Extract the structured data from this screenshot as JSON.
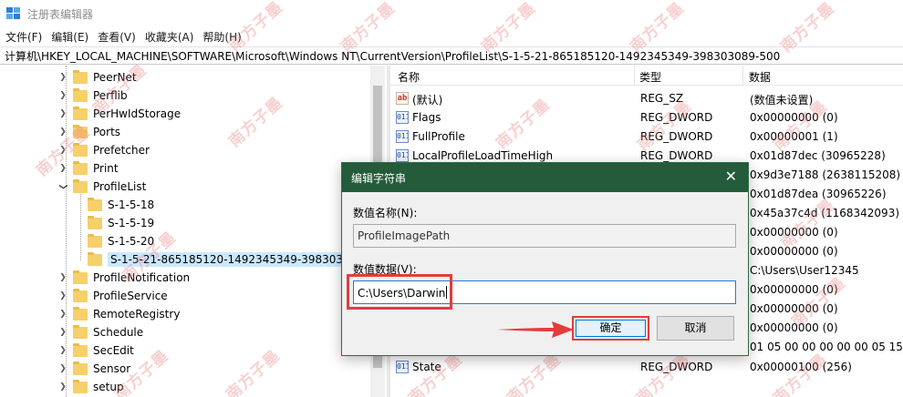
{
  "window": {
    "title": "注册表编辑器"
  },
  "menu": [
    "文件(F)",
    "编辑(E)",
    "查看(V)",
    "收藏夹(A)",
    "帮助(H)"
  ],
  "address": "计算机\\HKEY_LOCAL_MACHINE\\SOFTWARE\\Microsoft\\Windows NT\\CurrentVersion\\ProfileList\\S-1-5-21-865185120-1492345349-398303089-500",
  "tree": {
    "items": [
      {
        "label": "PeerNet",
        "expanded": false
      },
      {
        "label": "Perflib",
        "expanded": false
      },
      {
        "label": "PerHwIdStorage",
        "expanded": false
      },
      {
        "label": "Ports",
        "expanded": false
      },
      {
        "label": "Prefetcher",
        "expanded": false
      },
      {
        "label": "Print",
        "expanded": false
      },
      {
        "label": "ProfileList",
        "expanded": true
      },
      {
        "label": "S-1-5-18",
        "child": true
      },
      {
        "label": "S-1-5-19",
        "child": true
      },
      {
        "label": "S-1-5-20",
        "child": true
      },
      {
        "label": "S-1-5-21-865185120-1492345349-398303089",
        "child": true,
        "selected": true
      },
      {
        "label": "ProfileNotification",
        "expanded": false
      },
      {
        "label": "ProfileService",
        "expanded": false
      },
      {
        "label": "RemoteRegistry",
        "expanded": false
      },
      {
        "label": "Schedule",
        "expanded": false
      },
      {
        "label": "SecEdit",
        "expanded": false
      },
      {
        "label": "Sensor",
        "expanded": false
      },
      {
        "label": "setup",
        "expanded": false
      }
    ]
  },
  "values": {
    "headers": {
      "name": "名称",
      "type": "类型",
      "data": "数据"
    },
    "rows": [
      {
        "icon": "string-value-icon",
        "name": "(默认)",
        "type": "REG_SZ",
        "data": "(数值未设置)"
      },
      {
        "icon": "binary-value-icon",
        "name": "Flags",
        "type": "REG_DWORD",
        "data": "0x00000000 (0)"
      },
      {
        "icon": "binary-value-icon",
        "name": "FullProfile",
        "type": "REG_DWORD",
        "data": "0x00000001 (1)"
      },
      {
        "icon": "binary-value-icon",
        "name": "LocalProfileLoadTimeHigh",
        "type": "REG_DWORD",
        "data": "0x01d87dec (30965228)"
      },
      {
        "icon": "",
        "name": "",
        "type": "",
        "data": "0x9d3e7188 (2638115208)"
      },
      {
        "icon": "",
        "name": "",
        "type": "",
        "data": "0x01d87dea (30965226)"
      },
      {
        "icon": "",
        "name": "",
        "type": "",
        "data": "0x45a37c4d (1168342093)"
      },
      {
        "icon": "",
        "name": "",
        "type": "",
        "data": "0x00000000 (0)"
      },
      {
        "icon": "",
        "name": "",
        "type": "",
        "data": "0x00000000 (0)"
      },
      {
        "icon": "",
        "name": "",
        "type": "",
        "data": "C:\\Users\\User12345"
      },
      {
        "icon": "",
        "name": "",
        "type": "",
        "data": "0x00000000 (0)"
      },
      {
        "icon": "",
        "name": "",
        "type": "",
        "data": "0x00000000 (0)"
      },
      {
        "icon": "",
        "name": "",
        "type": "",
        "data": "0x00000000 (0)"
      },
      {
        "icon": "",
        "name": "",
        "type": "",
        "data": "01 05 00 00 00 00 00 05 15 0"
      },
      {
        "icon": "binary-value-icon",
        "name": "State",
        "type": "REG_DWORD",
        "data": "0x00000100 (256)"
      }
    ]
  },
  "dialog": {
    "title": "编辑字符串",
    "name_label": "数值名称(N):",
    "name_value": "ProfileImagePath",
    "data_label": "数值数据(V):",
    "data_value": "C:\\Users\\Darwin",
    "ok": "确定",
    "cancel": "取消",
    "close": "✕"
  },
  "watermark": "南方子墨",
  "colors": {
    "dialog_title_bg": "#245b3a",
    "highlight_red": "#e43c3c",
    "selection": "#cce8ff",
    "folder": "#f5d06b"
  }
}
